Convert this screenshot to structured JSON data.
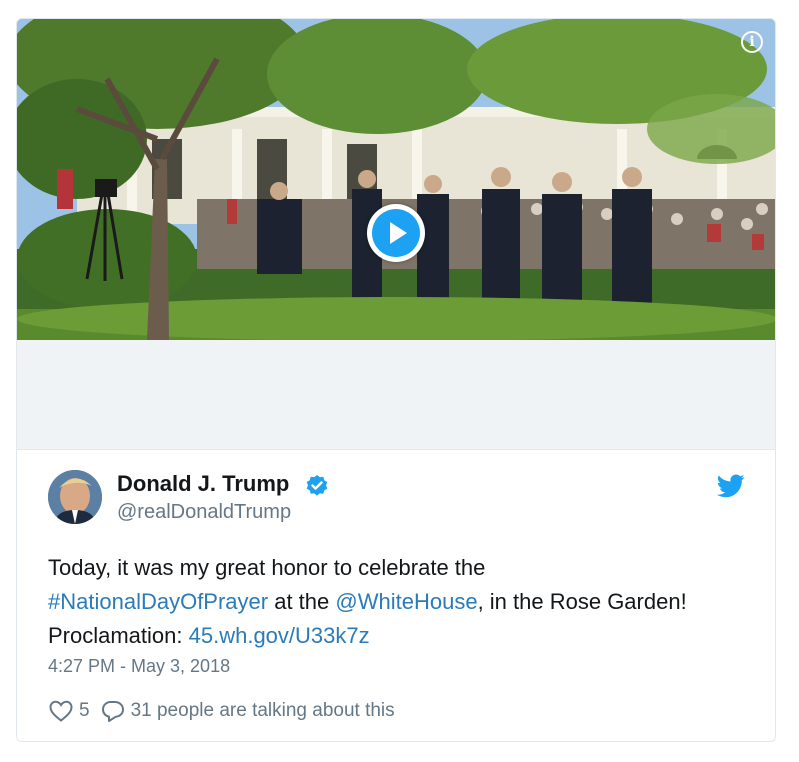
{
  "media": {
    "info_icon": "info-icon",
    "play_icon": "play-icon"
  },
  "tweet": {
    "author_name": "Donald J. Trump",
    "handle": "@realDonaldTrump",
    "verified_icon": "verified-badge-icon",
    "brand_icon": "twitter-bird-icon",
    "text_part1": "Today, it was my great honor to celebrate the",
    "hashtag": "#NationalDayOfPrayer",
    "text_part2": " at the ",
    "mention": "@WhiteHouse",
    "text_part3": ", in the Rose Garden!",
    "text_part4": "Proclamation: ",
    "url": "45.wh.gov/U33k7z",
    "timestamp": "4:27 PM - May 3, 2018",
    "likes": "5",
    "talking": "31 people are talking about this"
  },
  "colors": {
    "accent": "#1da1f2",
    "link": "#2b7bb9",
    "muted": "#657786",
    "text": "#14171a",
    "border": "#e1e8ed"
  }
}
